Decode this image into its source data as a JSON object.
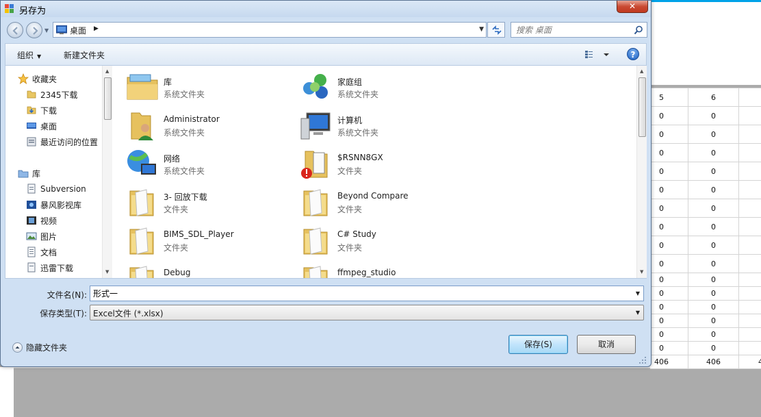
{
  "dialog": {
    "title": "另存为",
    "close_label": "✕"
  },
  "navbar": {
    "address": "桌面",
    "search_placeholder": "搜索 桌面"
  },
  "toolbar": {
    "organize": "组织",
    "new_folder": "新建文件夹"
  },
  "nav_pane": {
    "favorites_header": "收藏夹",
    "favorites": [
      "2345下载",
      "下载",
      "桌面",
      "最近访问的位置"
    ],
    "libraries_header": "库",
    "libraries": [
      "Subversion",
      "暴风影视库",
      "视频",
      "图片",
      "文档",
      "迅雷下载"
    ]
  },
  "files": [
    {
      "name": "库",
      "type": "系统文件夹",
      "icon": "library-icon"
    },
    {
      "name": "家庭组",
      "type": "系统文件夹",
      "icon": "homegroup-icon"
    },
    {
      "name": "Administrator",
      "type": "系统文件夹",
      "icon": "user-folder-icon"
    },
    {
      "name": "计算机",
      "type": "系统文件夹",
      "icon": "computer-icon"
    },
    {
      "name": "网络",
      "type": "系统文件夹",
      "icon": "network-icon"
    },
    {
      "name": "$RSNN8GX",
      "type": "文件夹",
      "icon": "warning-folder-icon"
    },
    {
      "name": "3- 回放下载",
      "type": "文件夹",
      "icon": "folder-icon"
    },
    {
      "name": "Beyond Compare",
      "type": "文件夹",
      "icon": "folder-icon"
    },
    {
      "name": "BIMS_SDL_Player",
      "type": "文件夹",
      "icon": "folder-icon"
    },
    {
      "name": "C# Study",
      "type": "文件夹",
      "icon": "folder-icon"
    },
    {
      "name": "Debug",
      "type": "",
      "icon": "folder-icon"
    },
    {
      "name": "ffmpeg_studio",
      "type": "",
      "icon": "folder-icon"
    }
  ],
  "form": {
    "filename_label": "文件名(N):",
    "filename_value": "形式一",
    "filetype_label": "保存类型(T):",
    "filetype_value": "Excel文件 (*.xlsx)",
    "hide_folders": "隐藏文件夹",
    "save": "保存(S)",
    "cancel": "取消"
  },
  "spreadsheet": {
    "headers": [
      "5",
      "6",
      ""
    ],
    "rows": [
      [
        "0",
        "0",
        ""
      ],
      [
        "0",
        "0",
        ""
      ],
      [
        "0",
        "0",
        ""
      ],
      [
        "0",
        "0",
        ""
      ],
      [
        "0",
        "0",
        ""
      ],
      [
        "0",
        "0",
        ""
      ],
      [
        "0",
        "0",
        ""
      ],
      [
        "0",
        "0",
        ""
      ],
      [
        "0",
        "0",
        ""
      ],
      [
        "0",
        "0",
        ""
      ],
      [
        "0",
        "0",
        ""
      ],
      [
        "0",
        "0",
        ""
      ],
      [
        "0",
        "0",
        ""
      ],
      [
        "0",
        "0",
        ""
      ],
      [
        "0",
        "0",
        ""
      ]
    ],
    "footer": [
      "406",
      "406",
      "4"
    ]
  },
  "colors": {
    "accent_blue": "#00a2e8",
    "dialog_frame": "#cfe0f3",
    "close_red": "#c94a33"
  }
}
